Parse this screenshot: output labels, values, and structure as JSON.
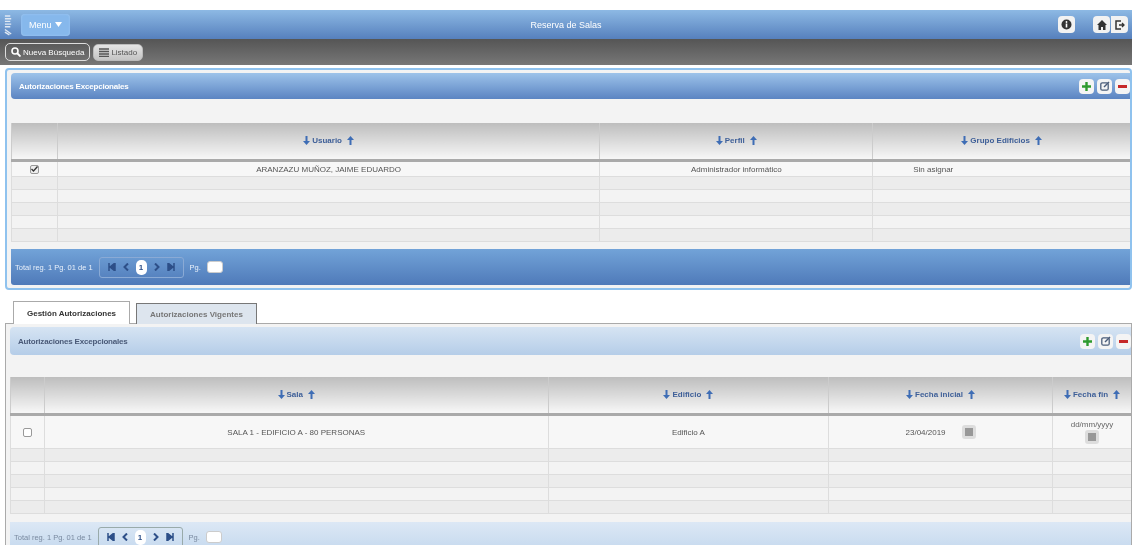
{
  "topbar": {
    "menu": "Menu",
    "title": "Reserva de Salas"
  },
  "toolbar": [
    {
      "label": "Nueva Búsqueda",
      "selected": false
    },
    {
      "label": "Listado",
      "selected": true
    }
  ],
  "panel_1": {
    "title": "Autorizaciones Excepcionales",
    "columns": [
      "Usuario",
      "Perfil",
      "Grupo Edificios"
    ],
    "rows": [
      {
        "checked": true,
        "cells": [
          "ARANZAZU MUÑOZ, JAIME EDUARDO",
          "Administrador informático",
          "Sin asignar"
        ]
      }
    ],
    "pager": {
      "total": "Total reg. 1 Pg. 01 de 1",
      "page": "1",
      "goto_label": "Pg."
    }
  },
  "tabs": [
    {
      "label": "Gestión Autorizaciones",
      "selected": true
    },
    {
      "label": "Autorizaciones Vigentes",
      "selected": false
    }
  ],
  "panel_2": {
    "title": "Autorizaciones Excepcionales",
    "columns": [
      "Sala",
      "Edificio",
      "Fecha inicial",
      "Fecha fin"
    ],
    "rows": [
      {
        "checked": false,
        "cells": [
          "SALA 1 - EDIFICIO A - 80 PERSONAS",
          "Edificio A"
        ],
        "fecha_inicial": {
          "value": "23/04/2019"
        },
        "fecha_fin": {
          "placeholder": "dd/mm/yyyy"
        }
      }
    ],
    "pager": {
      "total": "Total reg. 1 Pg. 01 de 1",
      "page": "1",
      "goto_label": "Pg."
    }
  }
}
